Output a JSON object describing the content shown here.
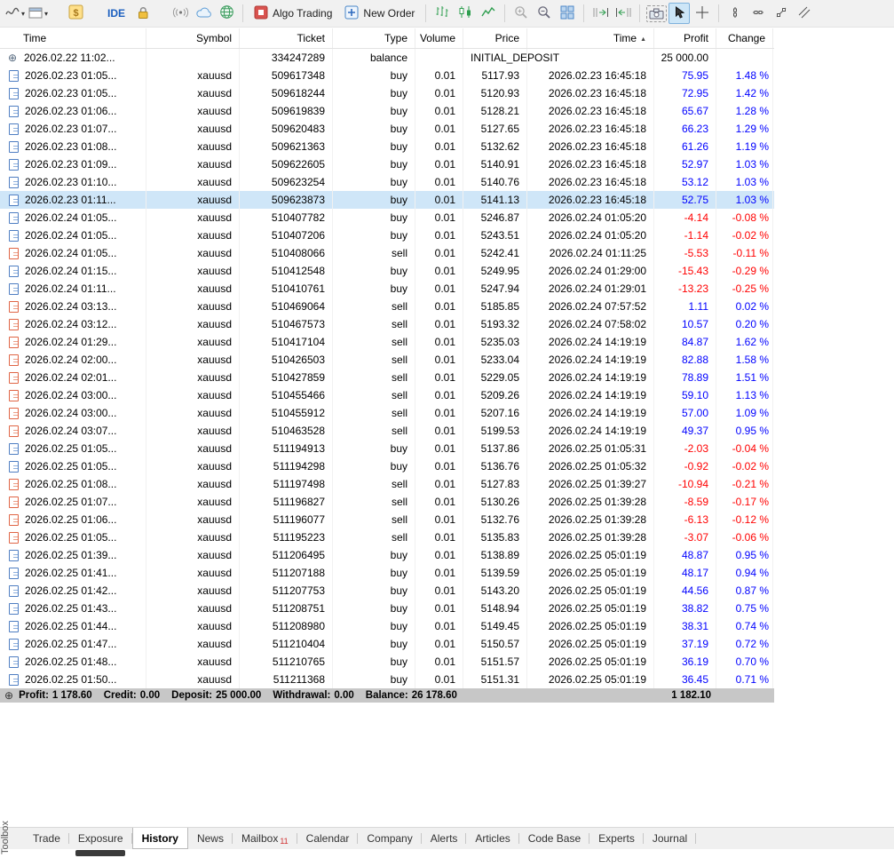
{
  "glyphs": {
    "dropdown": "▾",
    "close": "×",
    "sort_asc": "▲",
    "balance_plus": "⊕"
  },
  "toolbar": {
    "ide_label": "IDE",
    "algo_trading_label": "Algo Trading",
    "new_order_label": "New Order",
    "active_tool": "cursor",
    "icons": [
      "chart-line-type-icon",
      "chart-window-icon",
      "market-dollar-icon",
      "lock-icon",
      "signal-icon",
      "cloud-icon",
      "community-globe-icon",
      "algo-trading-icon",
      "new-order-icon",
      "bar-chart-icon",
      "candlestick-chart-icon",
      "line-chart-icon",
      "zoom-in-icon",
      "zoom-out-icon",
      "tile-windows-icon",
      "chart-shift-icon",
      "auto-scroll-icon",
      "camera-icon",
      "cursor-icon",
      "crosshair-icon",
      "vertical-line-icon",
      "horizontal-line-icon",
      "trendline-icon",
      "equidistant-channel-icon"
    ]
  },
  "history": {
    "columns": [
      "Time",
      "Symbol",
      "Ticket",
      "Type",
      "Volume",
      "Price",
      "Time",
      "Profit",
      "Change"
    ],
    "sort_column": "Time",
    "sort_direction": "ascending",
    "rows": [
      {
        "icon": "balance",
        "time": "2026.02.22 11:02...",
        "symbol": "",
        "ticket": "334247289",
        "type": "balance",
        "volume": "",
        "price": "INITIAL_DEPOSIT",
        "close_time": "",
        "profit": "25 000.00",
        "change": ""
      },
      {
        "icon": "buy",
        "time": "2026.02.23 01:05...",
        "symbol": "xauusd",
        "ticket": "509617348",
        "type": "buy",
        "volume": "0.01",
        "price": "5117.93",
        "close_time": "2026.02.23 16:45:18",
        "profit": "75.95",
        "change": "1.48 %"
      },
      {
        "icon": "buy",
        "time": "2026.02.23 01:05...",
        "symbol": "xauusd",
        "ticket": "509618244",
        "type": "buy",
        "volume": "0.01",
        "price": "5120.93",
        "close_time": "2026.02.23 16:45:18",
        "profit": "72.95",
        "change": "1.42 %"
      },
      {
        "icon": "buy",
        "time": "2026.02.23 01:06...",
        "symbol": "xauusd",
        "ticket": "509619839",
        "type": "buy",
        "volume": "0.01",
        "price": "5128.21",
        "close_time": "2026.02.23 16:45:18",
        "profit": "65.67",
        "change": "1.28 %"
      },
      {
        "icon": "buy",
        "time": "2026.02.23 01:07...",
        "symbol": "xauusd",
        "ticket": "509620483",
        "type": "buy",
        "volume": "0.01",
        "price": "5127.65",
        "close_time": "2026.02.23 16:45:18",
        "profit": "66.23",
        "change": "1.29 %"
      },
      {
        "icon": "buy",
        "time": "2026.02.23 01:08...",
        "symbol": "xauusd",
        "ticket": "509621363",
        "type": "buy",
        "volume": "0.01",
        "price": "5132.62",
        "close_time": "2026.02.23 16:45:18",
        "profit": "61.26",
        "change": "1.19 %"
      },
      {
        "icon": "buy",
        "time": "2026.02.23 01:09...",
        "symbol": "xauusd",
        "ticket": "509622605",
        "type": "buy",
        "volume": "0.01",
        "price": "5140.91",
        "close_time": "2026.02.23 16:45:18",
        "profit": "52.97",
        "change": "1.03 %"
      },
      {
        "icon": "buy",
        "time": "2026.02.23 01:10...",
        "symbol": "xauusd",
        "ticket": "509623254",
        "type": "buy",
        "volume": "0.01",
        "price": "5140.76",
        "close_time": "2026.02.23 16:45:18",
        "profit": "53.12",
        "change": "1.03 %"
      },
      {
        "icon": "buy",
        "time": "2026.02.23 01:11...",
        "symbol": "xauusd",
        "ticket": "509623873",
        "type": "buy",
        "volume": "0.01",
        "price": "5141.13",
        "close_time": "2026.02.23 16:45:18",
        "profit": "52.75",
        "change": "1.03 %",
        "selected": true
      },
      {
        "icon": "buy",
        "time": "2026.02.24 01:05...",
        "symbol": "xauusd",
        "ticket": "510407782",
        "type": "buy",
        "volume": "0.01",
        "price": "5246.87",
        "close_time": "2026.02.24 01:05:20",
        "profit": "-4.14",
        "change": "-0.08 %"
      },
      {
        "icon": "buy",
        "time": "2026.02.24 01:05...",
        "symbol": "xauusd",
        "ticket": "510407206",
        "type": "buy",
        "volume": "0.01",
        "price": "5243.51",
        "close_time": "2026.02.24 01:05:20",
        "profit": "-1.14",
        "change": "-0.02 %"
      },
      {
        "icon": "sell",
        "time": "2026.02.24 01:05...",
        "symbol": "xauusd",
        "ticket": "510408066",
        "type": "sell",
        "volume": "0.01",
        "price": "5242.41",
        "close_time": "2026.02.24 01:11:25",
        "profit": "-5.53",
        "change": "-0.11 %"
      },
      {
        "icon": "buy",
        "time": "2026.02.24 01:15...",
        "symbol": "xauusd",
        "ticket": "510412548",
        "type": "buy",
        "volume": "0.01",
        "price": "5249.95",
        "close_time": "2026.02.24 01:29:00",
        "profit": "-15.43",
        "change": "-0.29 %"
      },
      {
        "icon": "buy",
        "time": "2026.02.24 01:11...",
        "symbol": "xauusd",
        "ticket": "510410761",
        "type": "buy",
        "volume": "0.01",
        "price": "5247.94",
        "close_time": "2026.02.24 01:29:01",
        "profit": "-13.23",
        "change": "-0.25 %"
      },
      {
        "icon": "sell",
        "time": "2026.02.24 03:13...",
        "symbol": "xauusd",
        "ticket": "510469064",
        "type": "sell",
        "volume": "0.01",
        "price": "5185.85",
        "close_time": "2026.02.24 07:57:52",
        "profit": "1.11",
        "change": "0.02 %"
      },
      {
        "icon": "sell",
        "time": "2026.02.24 03:12...",
        "symbol": "xauusd",
        "ticket": "510467573",
        "type": "sell",
        "volume": "0.01",
        "price": "5193.32",
        "close_time": "2026.02.24 07:58:02",
        "profit": "10.57",
        "change": "0.20 %"
      },
      {
        "icon": "sell",
        "time": "2026.02.24 01:29...",
        "symbol": "xauusd",
        "ticket": "510417104",
        "type": "sell",
        "volume": "0.01",
        "price": "5235.03",
        "close_time": "2026.02.24 14:19:19",
        "profit": "84.87",
        "change": "1.62 %"
      },
      {
        "icon": "sell",
        "time": "2026.02.24 02:00...",
        "symbol": "xauusd",
        "ticket": "510426503",
        "type": "sell",
        "volume": "0.01",
        "price": "5233.04",
        "close_time": "2026.02.24 14:19:19",
        "profit": "82.88",
        "change": "1.58 %"
      },
      {
        "icon": "sell",
        "time": "2026.02.24 02:01...",
        "symbol": "xauusd",
        "ticket": "510427859",
        "type": "sell",
        "volume": "0.01",
        "price": "5229.05",
        "close_time": "2026.02.24 14:19:19",
        "profit": "78.89",
        "change": "1.51 %"
      },
      {
        "icon": "sell",
        "time": "2026.02.24 03:00...",
        "symbol": "xauusd",
        "ticket": "510455466",
        "type": "sell",
        "volume": "0.01",
        "price": "5209.26",
        "close_time": "2026.02.24 14:19:19",
        "profit": "59.10",
        "change": "1.13 %"
      },
      {
        "icon": "sell",
        "time": "2026.02.24 03:00...",
        "symbol": "xauusd",
        "ticket": "510455912",
        "type": "sell",
        "volume": "0.01",
        "price": "5207.16",
        "close_time": "2026.02.24 14:19:19",
        "profit": "57.00",
        "change": "1.09 %"
      },
      {
        "icon": "sell",
        "time": "2026.02.24 03:07...",
        "symbol": "xauusd",
        "ticket": "510463528",
        "type": "sell",
        "volume": "0.01",
        "price": "5199.53",
        "close_time": "2026.02.24 14:19:19",
        "profit": "49.37",
        "change": "0.95 %"
      },
      {
        "icon": "buy",
        "time": "2026.02.25 01:05...",
        "symbol": "xauusd",
        "ticket": "511194913",
        "type": "buy",
        "volume": "0.01",
        "price": "5137.86",
        "close_time": "2026.02.25 01:05:31",
        "profit": "-2.03",
        "change": "-0.04 %"
      },
      {
        "icon": "buy",
        "time": "2026.02.25 01:05...",
        "symbol": "xauusd",
        "ticket": "511194298",
        "type": "buy",
        "volume": "0.01",
        "price": "5136.76",
        "close_time": "2026.02.25 01:05:32",
        "profit": "-0.92",
        "change": "-0.02 %"
      },
      {
        "icon": "sell",
        "time": "2026.02.25 01:08...",
        "symbol": "xauusd",
        "ticket": "511197498",
        "type": "sell",
        "volume": "0.01",
        "price": "5127.83",
        "close_time": "2026.02.25 01:39:27",
        "profit": "-10.94",
        "change": "-0.21 %"
      },
      {
        "icon": "sell",
        "time": "2026.02.25 01:07...",
        "symbol": "xauusd",
        "ticket": "511196827",
        "type": "sell",
        "volume": "0.01",
        "price": "5130.26",
        "close_time": "2026.02.25 01:39:28",
        "profit": "-8.59",
        "change": "-0.17 %"
      },
      {
        "icon": "sell",
        "time": "2026.02.25 01:06...",
        "symbol": "xauusd",
        "ticket": "511196077",
        "type": "sell",
        "volume": "0.01",
        "price": "5132.76",
        "close_time": "2026.02.25 01:39:28",
        "profit": "-6.13",
        "change": "-0.12 %"
      },
      {
        "icon": "sell",
        "time": "2026.02.25 01:05...",
        "symbol": "xauusd",
        "ticket": "511195223",
        "type": "sell",
        "volume": "0.01",
        "price": "5135.83",
        "close_time": "2026.02.25 01:39:28",
        "profit": "-3.07",
        "change": "-0.06 %"
      },
      {
        "icon": "buy",
        "time": "2026.02.25 01:39...",
        "symbol": "xauusd",
        "ticket": "511206495",
        "type": "buy",
        "volume": "0.01",
        "price": "5138.89",
        "close_time": "2026.02.25 05:01:19",
        "profit": "48.87",
        "change": "0.95 %"
      },
      {
        "icon": "buy",
        "time": "2026.02.25 01:41...",
        "symbol": "xauusd",
        "ticket": "511207188",
        "type": "buy",
        "volume": "0.01",
        "price": "5139.59",
        "close_time": "2026.02.25 05:01:19",
        "profit": "48.17",
        "change": "0.94 %"
      },
      {
        "icon": "buy",
        "time": "2026.02.25 01:42...",
        "symbol": "xauusd",
        "ticket": "511207753",
        "type": "buy",
        "volume": "0.01",
        "price": "5143.20",
        "close_time": "2026.02.25 05:01:19",
        "profit": "44.56",
        "change": "0.87 %"
      },
      {
        "icon": "buy",
        "time": "2026.02.25 01:43...",
        "symbol": "xauusd",
        "ticket": "511208751",
        "type": "buy",
        "volume": "0.01",
        "price": "5148.94",
        "close_time": "2026.02.25 05:01:19",
        "profit": "38.82",
        "change": "0.75 %"
      },
      {
        "icon": "buy",
        "time": "2026.02.25 01:44...",
        "symbol": "xauusd",
        "ticket": "511208980",
        "type": "buy",
        "volume": "0.01",
        "price": "5149.45",
        "close_time": "2026.02.25 05:01:19",
        "profit": "38.31",
        "change": "0.74 %"
      },
      {
        "icon": "buy",
        "time": "2026.02.25 01:47...",
        "symbol": "xauusd",
        "ticket": "511210404",
        "type": "buy",
        "volume": "0.01",
        "price": "5150.57",
        "close_time": "2026.02.25 05:01:19",
        "profit": "37.19",
        "change": "0.72 %"
      },
      {
        "icon": "buy",
        "time": "2026.02.25 01:48...",
        "symbol": "xauusd",
        "ticket": "511210765",
        "type": "buy",
        "volume": "0.01",
        "price": "5151.57",
        "close_time": "2026.02.25 05:01:19",
        "profit": "36.19",
        "change": "0.70 %"
      },
      {
        "icon": "buy",
        "time": "2026.02.25 01:50...",
        "symbol": "xauusd",
        "ticket": "511211368",
        "type": "buy",
        "volume": "0.01",
        "price": "5151.31",
        "close_time": "2026.02.25 05:01:19",
        "profit": "36.45",
        "change": "0.71 %"
      }
    ],
    "summary": {
      "items": [
        {
          "label": "Profit:",
          "value": "1 178.60"
        },
        {
          "label": "Credit:",
          "value": "0.00"
        },
        {
          "label": "Deposit:",
          "value": "25 000.00"
        },
        {
          "label": "Withdrawal:",
          "value": "0.00"
        },
        {
          "label": "Balance:",
          "value": "26 178.60"
        }
      ],
      "total_change": "1 182.10"
    }
  },
  "tabs": [
    {
      "label": "Trade"
    },
    {
      "label": "Exposure"
    },
    {
      "label": "History",
      "active": true
    },
    {
      "label": "News"
    },
    {
      "label": "Mailbox",
      "badge": "11"
    },
    {
      "label": "Calendar"
    },
    {
      "label": "Company"
    },
    {
      "label": "Alerts"
    },
    {
      "label": "Articles"
    },
    {
      "label": "Code Base"
    },
    {
      "label": "Experts"
    },
    {
      "label": "Journal"
    }
  ],
  "toolbox_label": "Toolbox"
}
